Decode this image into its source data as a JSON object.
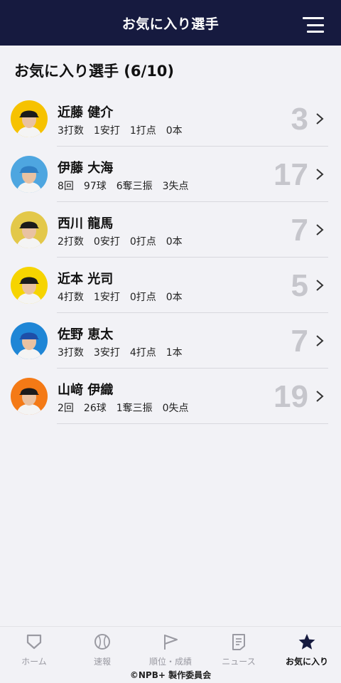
{
  "header": {
    "title": "お気に入り選手"
  },
  "section": {
    "title": "お気に入り選手 (6/10)"
  },
  "players": [
    {
      "name": "近藤 健介",
      "stats": "3打数　1安打　1打点　0本",
      "number": "3",
      "avatar_bg": "#f6c200",
      "cap": "#1b1b1b"
    },
    {
      "name": "伊藤 大海",
      "stats": "8回　97球　6奪三振　3失点",
      "number": "17",
      "avatar_bg": "#4ea6e0",
      "cap": "#2f7fc4"
    },
    {
      "name": "西川 龍馬",
      "stats": "2打数　0安打　0打点　0本",
      "number": "7",
      "avatar_bg": "#e3c84a",
      "cap": "#1b1b1b"
    },
    {
      "name": "近本 光司",
      "stats": "4打数　1安打　0打点　0本",
      "number": "5",
      "avatar_bg": "#f6d400",
      "cap": "#1b1b1b"
    },
    {
      "name": "佐野 恵太",
      "stats": "3打数　3安打　4打点　1本",
      "number": "7",
      "avatar_bg": "#1f86d6",
      "cap": "#1e4fa8"
    },
    {
      "name": "山﨑 伊織",
      "stats": "2回　26球　1奪三振　0失点",
      "number": "19",
      "avatar_bg": "#f47a16",
      "cap": "#1b1b1b"
    }
  ],
  "tabs": [
    {
      "label": "ホーム",
      "icon": "home-plate-icon"
    },
    {
      "label": "速報",
      "icon": "baseball-icon"
    },
    {
      "label": "順位・成績",
      "icon": "pennant-icon"
    },
    {
      "label": "ニュース",
      "icon": "news-icon"
    },
    {
      "label": "お気に入り",
      "icon": "star-icon",
      "active": true
    }
  ],
  "footer": {
    "copyright": "©NPB+ 製作委員会"
  },
  "colors": {
    "header_bg": "#161a3f",
    "number": "#c6c6cc",
    "tab_inactive": "#9a9aa2"
  }
}
